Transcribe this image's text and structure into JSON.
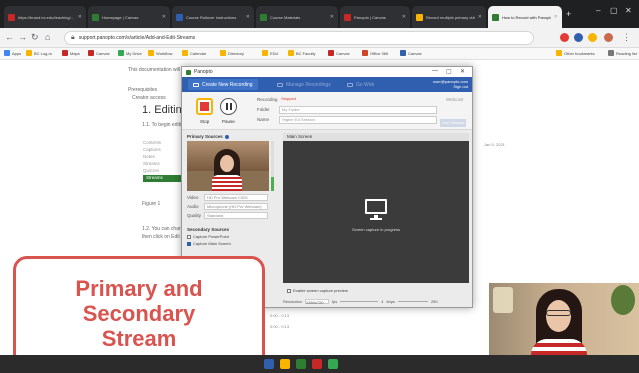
{
  "browser": {
    "tabs": [
      {
        "label": "https://brand.bc.edu/teaching/...",
        "color": "#c62828"
      },
      {
        "label": "Homepage | Canvas",
        "color": "#2e7d32"
      },
      {
        "label": "Course Rollover Instructions",
        "color": "#2f5fae"
      },
      {
        "label": "Course Materials",
        "color": "#2e7d32"
      },
      {
        "label": "Panopto | Canvas",
        "color": "#c62828"
      },
      {
        "label": "Record multiple primary video",
        "color": "#f7b500"
      },
      {
        "label": "How to Record with Panopto",
        "color": "#2e7d32"
      }
    ],
    "new_tab": "+",
    "url": "support.panopto.com/s/article/Add-and-Edit-Streams",
    "bookmarks": [
      "Apps",
      "BC Log-in",
      "Maps",
      "Canvas",
      "My Drive",
      "Workflow",
      "Calendar",
      "Directory",
      "EDU",
      "BC Faculty",
      "Canvas",
      "Office 365",
      "Canvas",
      "Other bookmarks",
      "Reading list"
    ],
    "colors": {
      "chrome": "#1f2022",
      "accent": "#2f5fae"
    }
  },
  "article": {
    "intro": "This documentation will go over the multiple ways to add and edit streams in the Panopto editor.",
    "prereq_label": "Prerequisites",
    "prereq_item": "Creator access",
    "heading": "1. Editing the",
    "step1": "1.1. To begin editi",
    "side_items": [
      "Contents",
      "Captions",
      "Notes",
      "Streams",
      "Quizzes",
      "Search"
    ],
    "selected_side": "Streams",
    "figure": "Figure 1",
    "step2": "1.2. You can change",
    "step2b": "then click on Edit",
    "right_note": "Jan 5, 2021"
  },
  "recorder": {
    "app_name": "Panopto",
    "window_controls": [
      "—",
      "▢",
      "✕"
    ],
    "tabs": [
      {
        "label": "Create New Recording",
        "active": true
      },
      {
        "label": "Manage Recordings",
        "active": false
      },
      {
        "label": "Go Web",
        "active": false
      }
    ],
    "user": {
      "name": "user@panopto.com",
      "signout": "Sign out"
    },
    "record_label": "Stop",
    "pause_label": "Pause",
    "fields": {
      "recording_label": "Recording",
      "recording_value": "Stopped",
      "folder_label": "Folder",
      "folder_value": "My Folder",
      "name_label": "Name",
      "name_value": "Higher Ed Session",
      "webcast_label": "Webcast",
      "join_label": "Join Session"
    },
    "primary_sources": {
      "title": "Primary Sources",
      "video_label": "Video",
      "video_value": "HD Pro Webcam C920",
      "audio_label": "Audio",
      "audio_value": "Microphone (HD Pro Webcam)",
      "quality_label": "Quality",
      "quality_value": "Standard",
      "audio_level": 0.28
    },
    "secondary_sources": {
      "title": "Secondary Sources",
      "items": [
        {
          "label": "Capture PowerPoint",
          "checked": false
        },
        {
          "label": "Capture Main Screen",
          "checked": true
        }
      ]
    },
    "screen_tab": "Main Screen",
    "screen_message": "Screen capture in progress",
    "fullscreen_label": "Enable screen capture preview",
    "resolution_label": "Resolution",
    "resolution_value": "1280x720",
    "fps_label": "fps",
    "fps_value": "4",
    "kbps_label": "kbps",
    "kbps_value": "250"
  },
  "callout": {
    "line1": "Primary and",
    "line2": "Secondary",
    "line3": "Stream",
    "color": "#d9534f"
  },
  "timestamps": [
    "0:00 - 0:13",
    "0:00 - 0:13"
  ]
}
